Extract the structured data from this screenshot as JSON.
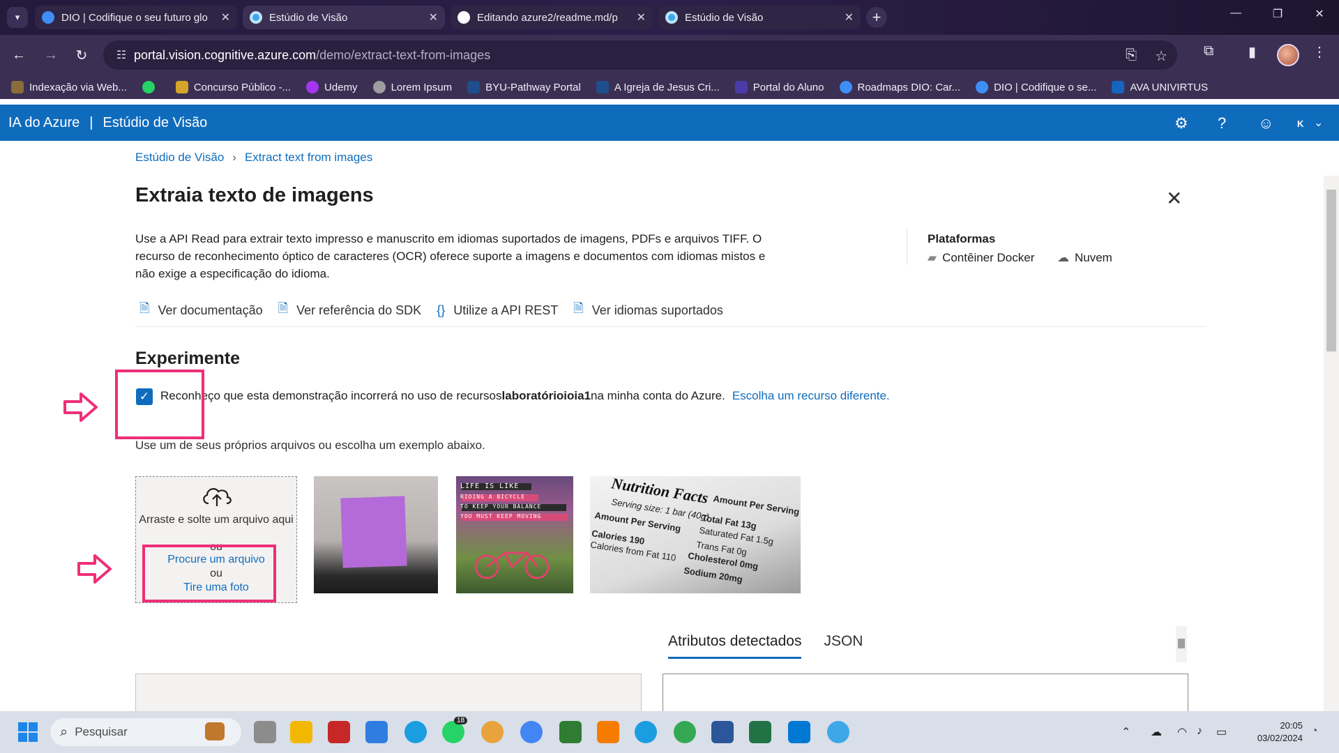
{
  "browser": {
    "tabs": [
      {
        "title": "DIO | Codifique o seu futuro glo",
        "active": false
      },
      {
        "title": "Estúdio de Visão",
        "active": true
      },
      {
        "title": "Editando azure2/readme.md/p",
        "active": false
      },
      {
        "title": "Estúdio de Visão",
        "active": false
      }
    ],
    "url_host": "portal.vision.cognitive.azure.com",
    "url_path": "/demo/extract-text-from-images",
    "bookmarks": [
      "Indexação via Web...",
      "",
      "Concurso Público -...",
      "Udemy",
      "Lorem Ipsum",
      "BYU-Pathway Portal",
      "A Igreja de Jesus Cri...",
      "Portal do Aluno",
      "Roadmaps DIO: Car...",
      "DIO | Codifique o se...",
      "AVA UNIVIRTUS"
    ]
  },
  "azure": {
    "brand": "IA do Azure",
    "separator": "|",
    "app": "Estúdio de Visão",
    "user_initial": "K"
  },
  "breadcrumb": {
    "root": "Estúdio de Visão",
    "current": "Extract text from images"
  },
  "page": {
    "title": "Extraia texto de imagens",
    "description": "Use a API Read para extrair texto impresso e manuscrito em idiomas suportados de imagens, PDFs e arquivos TIFF. O recurso de reconhecimento óptico de caracteres (OCR) oferece suporte a imagens e documentos com idiomas mistos e não exige a especificação do idioma.",
    "platforms_title": "Plataformas",
    "platforms": [
      "Contêiner Docker",
      "Nuvem"
    ],
    "links": [
      "Ver documentação",
      "Ver referência do SDK",
      "Utilize a API REST",
      "Ver idiomas suportados"
    ]
  },
  "try": {
    "title": "Experimente",
    "ack_prefix": "Reconheço que esta demonstração incorrerá no uso de recursos",
    "resource": "laboratórioioia1",
    "ack_suffix": "na minha conta do Azure.",
    "other_resource": "Escolha um recurso diferente.",
    "checked": true,
    "hint": "Use um de seus próprios arquivos ou escolha um exemplo abaixo.",
    "drop_text": "Arraste e solte um arquivo aqui",
    "or": "ou",
    "browse": "Procure um arquivo",
    "photo": "Tire uma foto",
    "sample2_lines": [
      "LIFE IS LIKE",
      "RIDING A BICYCLE",
      "TO KEEP YOUR BALANCE",
      "YOU MUST KEEP MOVING"
    ],
    "sample3_lines": [
      "Nutrition Facts",
      "Serving size: 1 bar (40g)",
      "Amount Per Serving",
      "Total Fat 13g",
      "Saturated Fat 1.5g",
      "Trans Fat 0g",
      "Cholesterol 0mg",
      "Sodium 20mg",
      "Amount Per Serving",
      "Calories 190",
      "Calories from Fat 110"
    ]
  },
  "results": {
    "tabs": [
      "Atributos detectados",
      "JSON"
    ],
    "active_tab": 0
  },
  "taskbar": {
    "search_placeholder": "Pesquisar",
    "whatsapp_badge": "18",
    "time": "20:05",
    "date": "03/02/2024"
  },
  "colors": {
    "azure_blue": "#0f6cbd",
    "annotation": "#ee2f78",
    "chrome_dark": "#3b3054"
  }
}
